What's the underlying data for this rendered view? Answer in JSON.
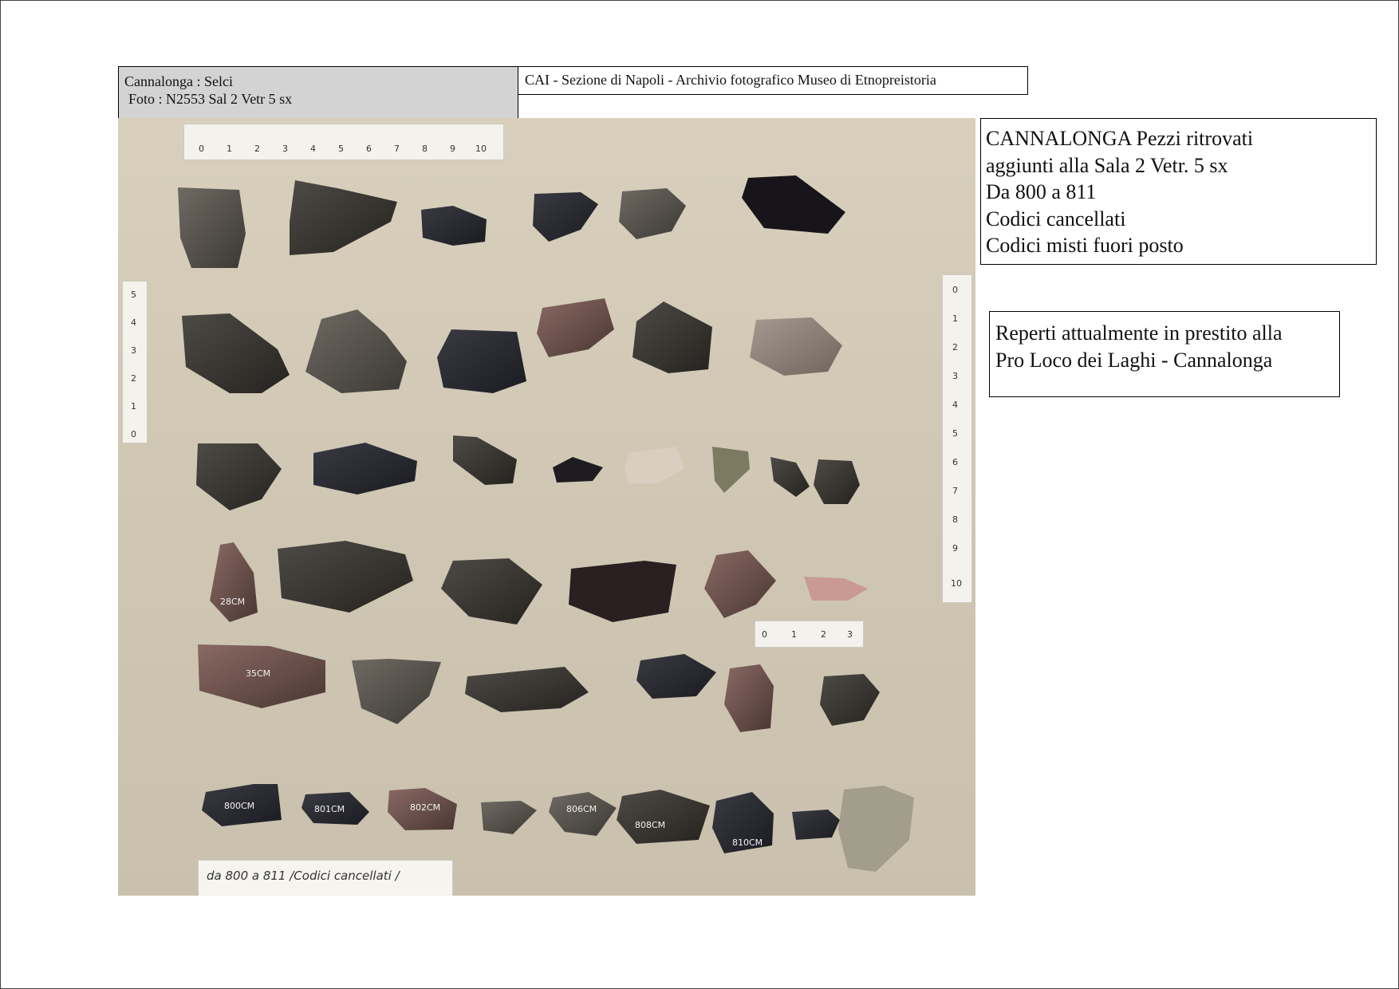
{
  "header": {
    "left_line1": "Cannalonga  :  Selci",
    "left_line2": "Foto : N2553   Sal 2 Vetr 5 sx",
    "archive": "CAI - Sezione di Napoli  - Archivio fotografico Museo di Etnopreistoria"
  },
  "info": {
    "lines": [
      "CANNALONGA Pezzi ritrovati",
      "aggiunti alla   Sala 2  Vetr. 5 sx",
      "Da 800 a  811",
      "Codici cancellati",
      "Codici misti fuori posto"
    ]
  },
  "loan": {
    "lines": [
      "Reperti attualmente in prestito alla",
      "Pro Loco dei Laghi - Cannalonga"
    ]
  },
  "photo": {
    "ruler_top_ticks": [
      "0",
      "1",
      "2",
      "3",
      "4",
      "5",
      "6",
      "7",
      "8",
      "9",
      "10"
    ],
    "ruler_right_ticks": [
      "0",
      "1",
      "2",
      "3",
      "4",
      "5",
      "6",
      "7",
      "8",
      "9",
      "10"
    ],
    "ruler_left_ticks": [
      "0",
      "1",
      "2",
      "3",
      "4",
      "5"
    ],
    "ruler_small_ticks": [
      "0",
      "1",
      "2",
      "3"
    ],
    "note_text": "da 800 a 811 /Codici cancellati /",
    "stone_labels": [
      "28CM",
      "35CM",
      "800CM",
      "801CM",
      "802CM",
      "806CM",
      "808CM",
      "810CM"
    ]
  }
}
